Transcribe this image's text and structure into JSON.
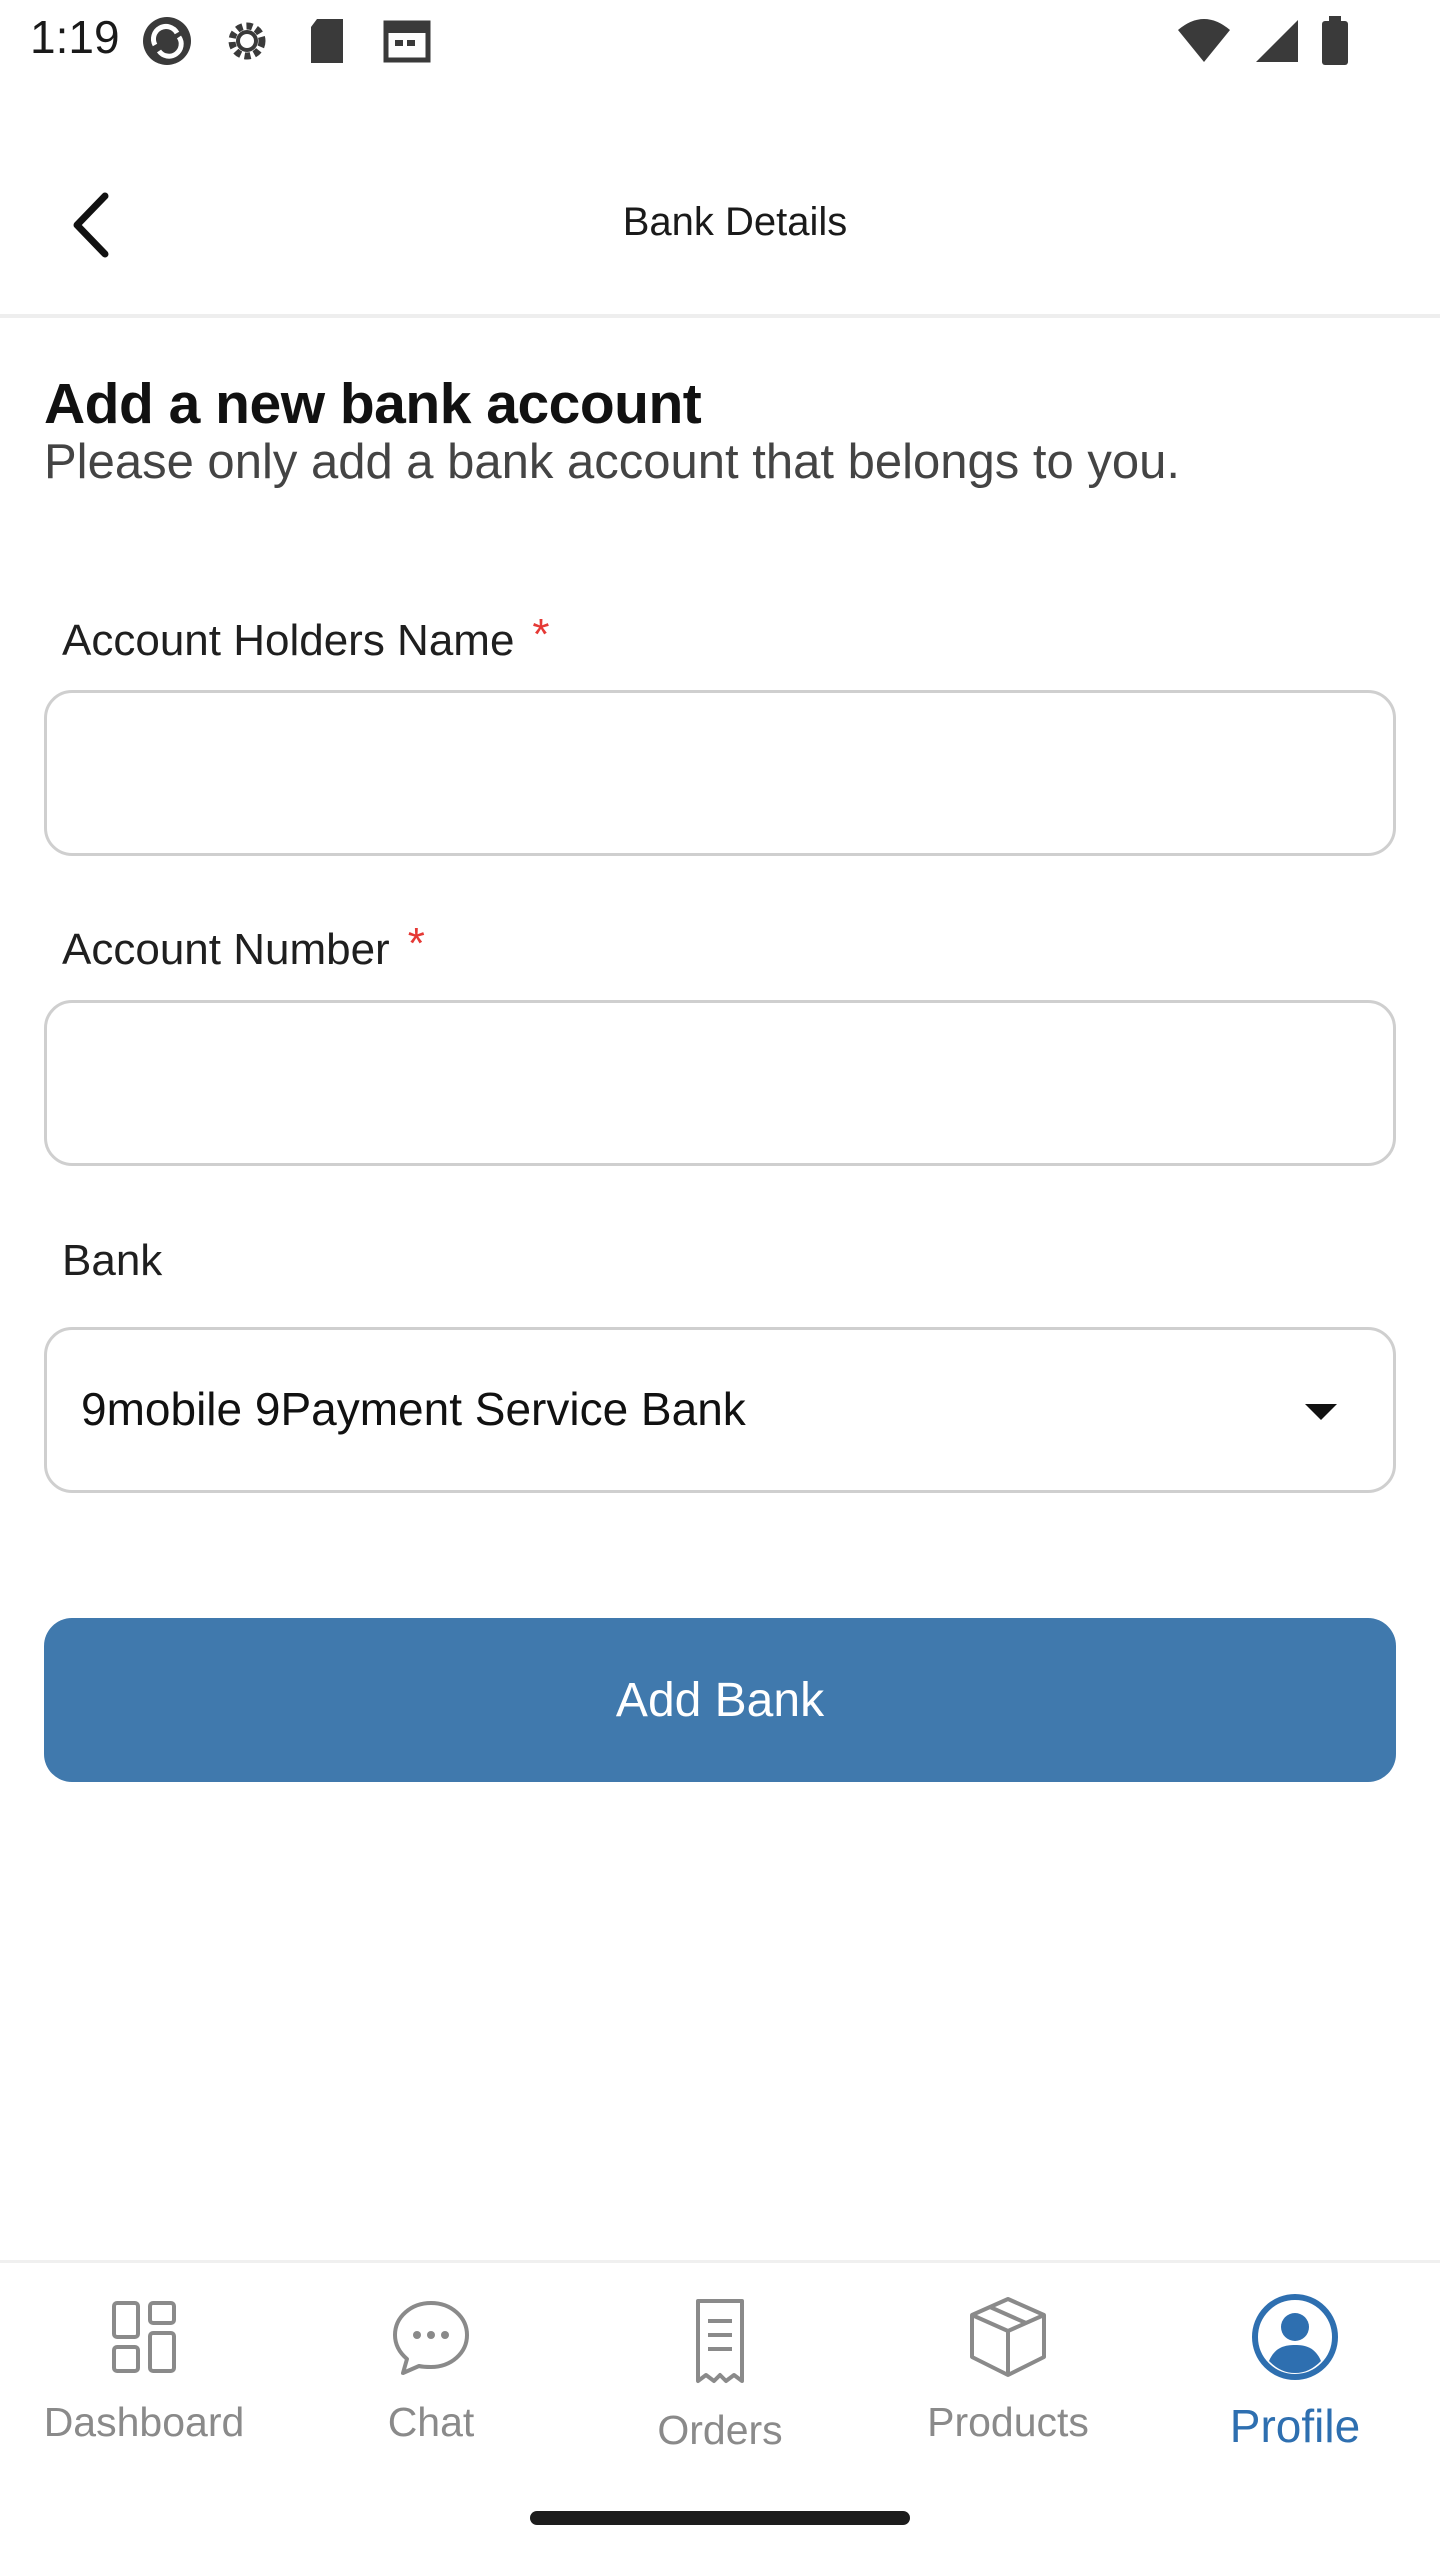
{
  "status_bar": {
    "time": "1:19",
    "left_icons": [
      "sync-icon",
      "gear-icon",
      "sd-card-icon",
      "calendar-icon"
    ],
    "right_icons": [
      "wifi-icon",
      "signal-icon",
      "battery-icon"
    ]
  },
  "app_bar": {
    "title": "Bank Details",
    "back_icon": "chevron-left-icon"
  },
  "form": {
    "heading": "Add a new bank account",
    "subheading": "Please only add a bank account that belongs to you.",
    "fields": [
      {
        "label": "Account Holders Name",
        "required": "*",
        "value": "",
        "placeholder": ""
      },
      {
        "label": "Account Number",
        "required": "*",
        "value": "",
        "placeholder": ""
      }
    ],
    "bank": {
      "label": "Bank",
      "selected": "9mobile 9Payment Service Bank",
      "caret_icon": "caret-down-icon"
    },
    "submit_label": "Add Bank"
  },
  "bottom_nav": {
    "items": [
      {
        "label": "Dashboard",
        "icon": "dashboard-icon"
      },
      {
        "label": "Chat",
        "icon": "chat-icon"
      },
      {
        "label": "Orders",
        "icon": "receipt-icon"
      },
      {
        "label": "Products",
        "icon": "box-icon"
      },
      {
        "label": "Profile",
        "icon": "user-circle-icon"
      }
    ],
    "active": "Profile"
  },
  "colors": {
    "primary": "#4079ad",
    "active_nav": "#2e6fb0",
    "required": "#e53935",
    "inactive_nav": "#8a8a8a"
  }
}
